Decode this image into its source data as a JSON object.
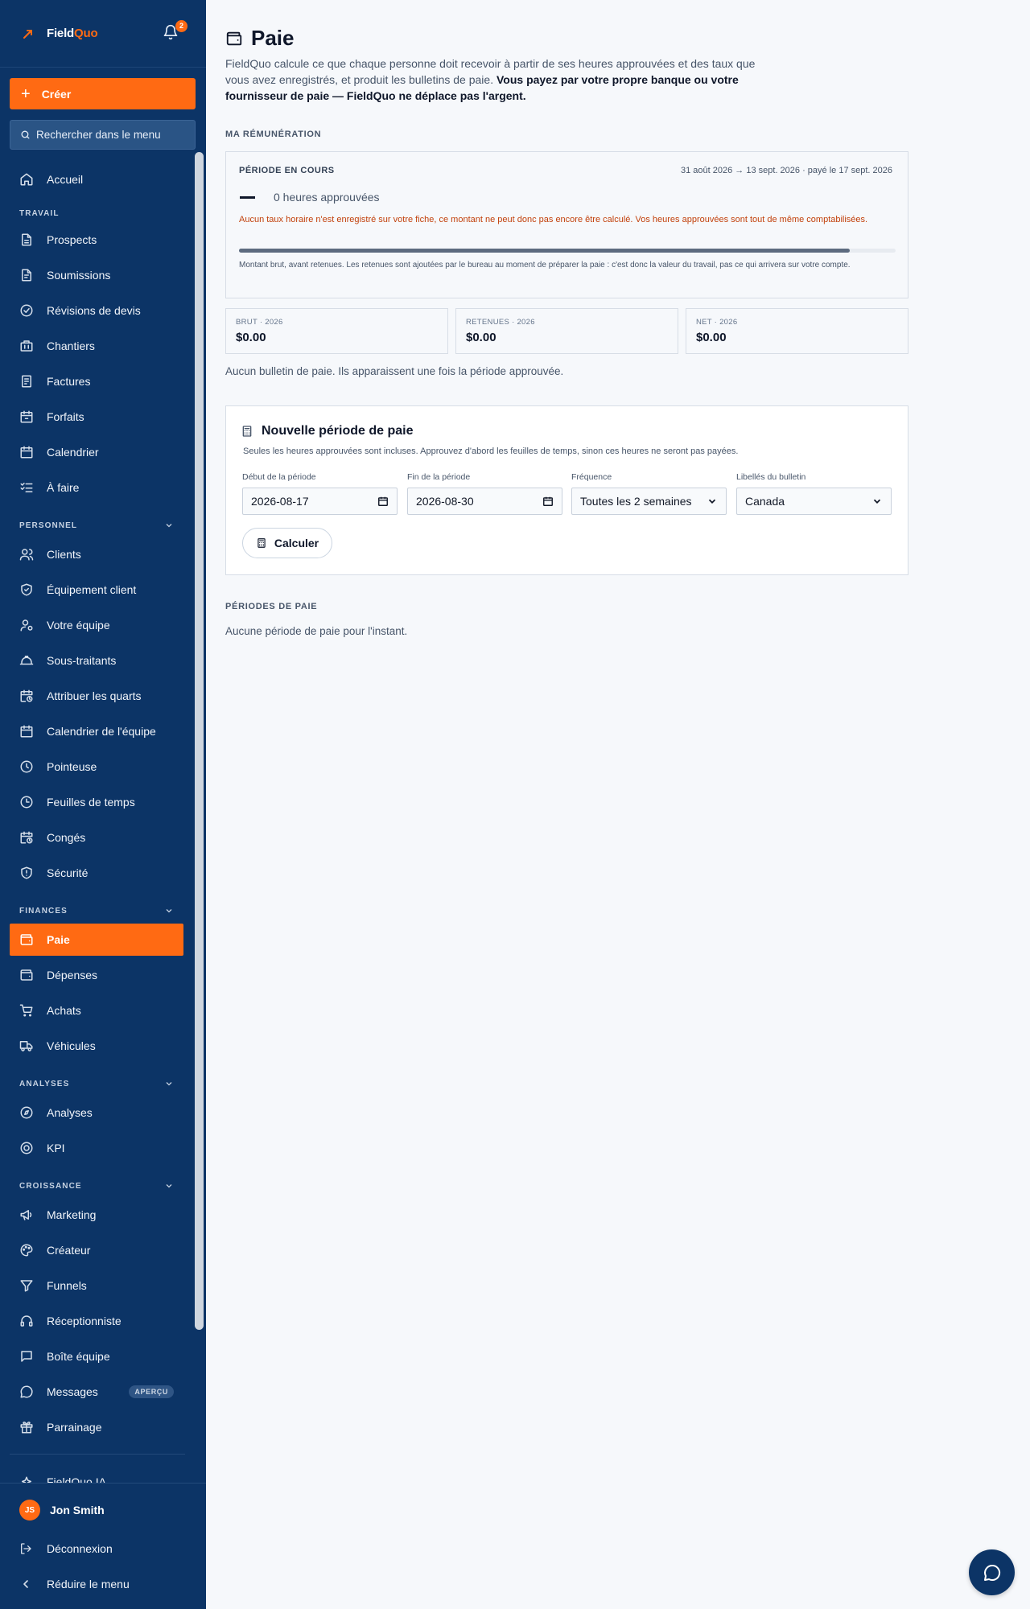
{
  "brand": {
    "name_a": "Field",
    "name_b": "Quo",
    "accent": "#ff6a13",
    "sidebar_bg": "#0c3466"
  },
  "notifications": {
    "count": "2",
    "icon": "bell-icon"
  },
  "sidebar": {
    "create_label": "Créer",
    "search_placeholder": "Rechercher dans le menu",
    "home": "Accueil",
    "sections": {
      "travail": "TRAVAIL",
      "personnel": "PERSONNEL",
      "finances": "FINANCES",
      "analyses": "ANALYSES",
      "croissance": "CROISSANCE"
    },
    "items": {
      "prospects": "Prospects",
      "soumissions": "Soumissions",
      "revisions": "Révisions de devis",
      "chantiers": "Chantiers",
      "factures": "Factures",
      "forfaits": "Forfaits",
      "calendrier": "Calendrier",
      "a_faire": "À faire",
      "clients": "Clients",
      "equipement": "Équipement client",
      "equipe": "Votre équipe",
      "sous_traitants": "Sous-traitants",
      "quarts": "Attribuer les quarts",
      "calendrier_equipe": "Calendrier de l'équipe",
      "pointeuse": "Pointeuse",
      "feuilles": "Feuilles de temps",
      "conges": "Congés",
      "securite": "Sécurité",
      "paie": "Paie",
      "depenses": "Dépenses",
      "achats": "Achats",
      "vehicules": "Véhicules",
      "analyses": "Analyses",
      "kpi": "KPI",
      "marketing": "Marketing",
      "createur": "Créateur",
      "funnels": "Funnels",
      "receptionniste": "Réceptionniste",
      "boite": "Boîte équipe",
      "messages": "Messages",
      "messages_badge": "APERÇU",
      "parrainage": "Parrainage",
      "ia": "FieldQuo IA"
    },
    "user": {
      "initials": "JS",
      "name": "Jon Smith"
    },
    "logout": "Déconnexion",
    "collapse": "Réduire le menu"
  },
  "page": {
    "title": "Paie",
    "intro_plain": "FieldQuo calcule ce que chaque personne doit recevoir à partir de ses heures approuvées et des taux que vous avez enregistrés, et produit les bulletins de paie. ",
    "intro_bold": "Vous payez par votre propre banque ou votre fournisseur de paie — FieldQuo ne déplace pas l'argent.",
    "my_pay_caption": "MA RÉMUNÉRATION",
    "current_period": {
      "label": "PÉRIODE EN COURS",
      "dates": "31 août 2026 → 13 sept. 2026 · payé le 17 sept. 2026",
      "hours": "0 heures approuvées",
      "warning": "Aucun taux horaire n'est enregistré sur votre fiche, ce montant ne peut donc pas encore être calculé. Vos heures approuvées sont tout de même comptabilisées.",
      "progress": 0.93,
      "note": "Montant brut, avant retenues. Les retenues sont ajoutées par le bureau au moment de préparer la paie : c'est donc la valeur du travail, pas ce qui arrivera sur votre compte."
    },
    "summary": [
      {
        "label": "BRUT · 2026",
        "value": "$0.00"
      },
      {
        "label": "RETENUES · 2026",
        "value": "$0.00"
      },
      {
        "label": "NET · 2026",
        "value": "$0.00"
      }
    ],
    "no_bulletin": "Aucun bulletin de paie. Ils apparaissent une fois la période approuvée.",
    "new_period": {
      "title": "Nouvelle période de paie",
      "subtitle": "Seules les heures approuvées sont incluses. Approuvez d'abord les feuilles de temps, sinon ces heures ne seront pas payées.",
      "start_label": "Début de la période",
      "start_value": "2026-08-17",
      "end_label": "Fin de la période",
      "end_value": "2026-08-30",
      "frequency_label": "Fréquence",
      "frequency_value": "Toutes les 2 semaines",
      "labels_label": "Libellés du bulletin",
      "labels_value": "Canada",
      "calculate": "Calculer"
    },
    "periods_caption": "PÉRIODES DE PAIE",
    "no_periods": "Aucune période de paie pour l'instant."
  }
}
